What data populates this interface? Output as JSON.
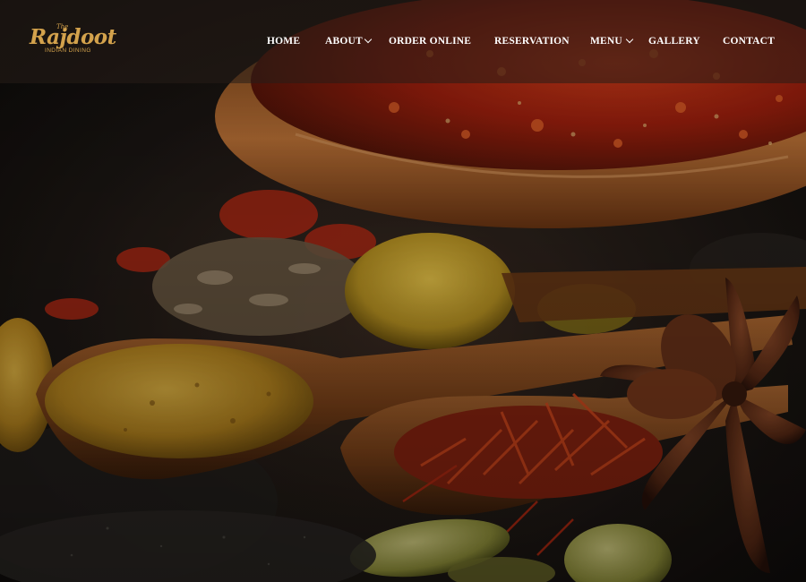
{
  "brand": {
    "logo_prefix": "The",
    "logo_name": "Rajdoot",
    "logo_tagline": "INDIAN DINING",
    "accent_color": "#d3a24c"
  },
  "nav": {
    "items": [
      {
        "label": "HOME",
        "has_dropdown": false
      },
      {
        "label": "ABOUT",
        "has_dropdown": true
      },
      {
        "label": "ORDER ONLINE",
        "has_dropdown": false
      },
      {
        "label": "RESERVATION",
        "has_dropdown": false
      },
      {
        "label": "MENU",
        "has_dropdown": true
      },
      {
        "label": "GALLERY",
        "has_dropdown": false
      },
      {
        "label": "CONTACT",
        "has_dropdown": false
      }
    ],
    "dropdown_icon": "chevron-down-icon"
  }
}
